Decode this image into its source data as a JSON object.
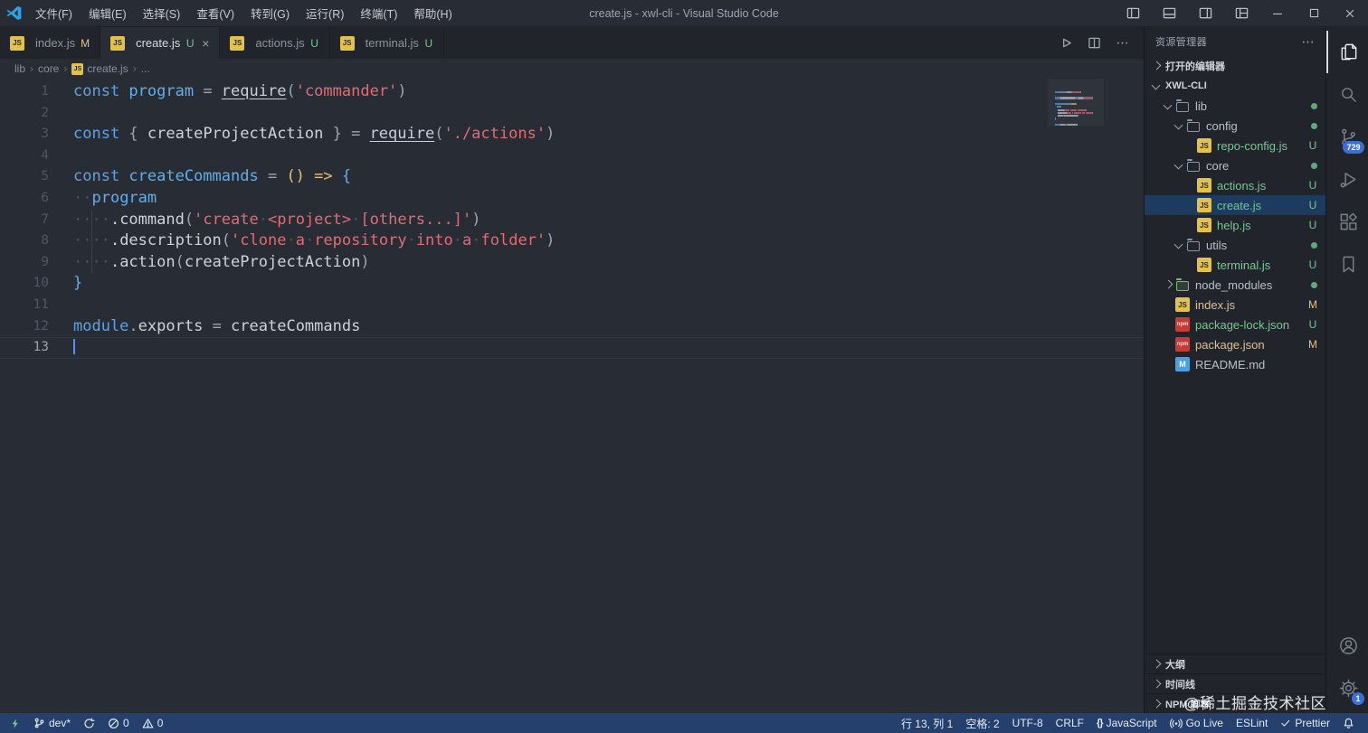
{
  "window": {
    "title": "create.js - xwl-cli - Visual Studio Code"
  },
  "menus": [
    "文件(F)",
    "编辑(E)",
    "选择(S)",
    "查看(V)",
    "转到(G)",
    "运行(R)",
    "终端(T)",
    "帮助(H)"
  ],
  "icon_glyphs": {
    "js": "JS",
    "npm": "npm",
    "md": "M"
  },
  "tabs": [
    {
      "label": "index.js",
      "badge": "M",
      "active": false
    },
    {
      "label": "create.js",
      "badge": "U",
      "active": true
    },
    {
      "label": "actions.js",
      "badge": "U",
      "active": false
    },
    {
      "label": "terminal.js",
      "badge": "U",
      "active": false
    }
  ],
  "breadcrumb": {
    "items": [
      {
        "label": "lib"
      },
      {
        "label": "core"
      },
      {
        "label": "create.js",
        "icon": "js"
      },
      {
        "label": "..."
      }
    ]
  },
  "editor": {
    "cursor_line": 13,
    "token_colors": {
      "kw": "#5da2e8",
      "id": "#61afef",
      "plain": "#ccd3dd",
      "pun": "#9da5b4",
      "str": "#e06c75",
      "gold": "#e5c07b",
      "ws": "#4a5160",
      "fn": "#c8cedb"
    },
    "lines": [
      {
        "n": 1,
        "t": [
          [
            "kw",
            "const "
          ],
          [
            "id",
            "program"
          ],
          [
            "pun",
            " = "
          ],
          [
            "fn",
            "require"
          ],
          [
            "pun",
            "("
          ],
          [
            "str",
            "'commander'"
          ],
          [
            "pun",
            ")"
          ]
        ]
      },
      {
        "n": 2,
        "t": []
      },
      {
        "n": 3,
        "t": [
          [
            "kw",
            "const "
          ],
          [
            "pun",
            "{ "
          ],
          [
            "plain",
            "createProjectAction"
          ],
          [
            "pun",
            " } = "
          ],
          [
            "fn",
            "require"
          ],
          [
            "pun",
            "("
          ],
          [
            "str",
            "'./actions'"
          ],
          [
            "pun",
            ")"
          ]
        ]
      },
      {
        "n": 4,
        "t": []
      },
      {
        "n": 5,
        "t": [
          [
            "kw",
            "const "
          ],
          [
            "id",
            "createCommands"
          ],
          [
            "pun",
            " = "
          ],
          [
            "gold",
            "() "
          ],
          [
            "gold",
            "=> "
          ],
          [
            "id",
            "{"
          ]
        ]
      },
      {
        "n": 6,
        "t": [
          [
            "ws",
            "··"
          ],
          [
            "id",
            "program"
          ]
        ]
      },
      {
        "n": 7,
        "t": [
          [
            "ws",
            "····"
          ],
          [
            "plain",
            ".command"
          ],
          [
            "pun",
            "("
          ],
          [
            "str",
            "'create"
          ],
          [
            "ws",
            "·"
          ],
          [
            "str",
            "<project>"
          ],
          [
            "ws",
            "·"
          ],
          [
            "str",
            "[others...]'"
          ],
          [
            "pun",
            ")"
          ]
        ]
      },
      {
        "n": 8,
        "t": [
          [
            "ws",
            "····"
          ],
          [
            "plain",
            ".description"
          ],
          [
            "pun",
            "("
          ],
          [
            "str",
            "'clone"
          ],
          [
            "ws",
            "·"
          ],
          [
            "str",
            "a"
          ],
          [
            "ws",
            "·"
          ],
          [
            "str",
            "repository"
          ],
          [
            "ws",
            "·"
          ],
          [
            "str",
            "into"
          ],
          [
            "ws",
            "·"
          ],
          [
            "str",
            "a"
          ],
          [
            "ws",
            "·"
          ],
          [
            "str",
            "folder'"
          ],
          [
            "pun",
            ")"
          ]
        ]
      },
      {
        "n": 9,
        "t": [
          [
            "ws",
            "····"
          ],
          [
            "plain",
            ".action"
          ],
          [
            "pun",
            "("
          ],
          [
            "plain",
            "createProjectAction"
          ],
          [
            "pun",
            ")"
          ]
        ]
      },
      {
        "n": 10,
        "t": [
          [
            "id",
            "}"
          ]
        ]
      },
      {
        "n": 11,
        "t": []
      },
      {
        "n": 12,
        "t": [
          [
            "kw",
            "module"
          ],
          [
            "pun",
            "."
          ],
          [
            "plain",
            "exports"
          ],
          [
            "pun",
            " = "
          ],
          [
            "plain",
            "createCommands"
          ]
        ]
      },
      {
        "n": 13,
        "t": []
      }
    ]
  },
  "sidebar": {
    "title": "资源管理器",
    "open_editors_label": "打开的编辑器",
    "project": "XWL-CLI",
    "tree": [
      {
        "indent": 0,
        "chev": "down",
        "icon": "folder",
        "label": "lib",
        "dot": true
      },
      {
        "indent": 1,
        "chev": "down",
        "icon": "folder",
        "label": "config",
        "dot": true
      },
      {
        "indent": 2,
        "icon": "js",
        "label": "repo-config.js",
        "git": "U"
      },
      {
        "indent": 1,
        "chev": "down",
        "icon": "folder",
        "label": "core",
        "dot": true
      },
      {
        "indent": 2,
        "icon": "js",
        "label": "actions.js",
        "git": "U"
      },
      {
        "indent": 2,
        "icon": "js",
        "label": "create.js",
        "git": "U",
        "selected": true
      },
      {
        "indent": 2,
        "icon": "js",
        "label": "help.js",
        "git": "U"
      },
      {
        "indent": 1,
        "chev": "down",
        "icon": "folder",
        "label": "utils",
        "dot": true
      },
      {
        "indent": 2,
        "icon": "js",
        "label": "terminal.js",
        "git": "U"
      },
      {
        "indent": 0,
        "chev": "right",
        "icon": "folder-node",
        "label": "node_modules",
        "dot": true
      },
      {
        "indent": 0,
        "icon": "js",
        "label": "index.js",
        "git": "M"
      },
      {
        "indent": 0,
        "icon": "npm",
        "label": "package-lock.json",
        "git": "U"
      },
      {
        "indent": 0,
        "icon": "npm",
        "label": "package.json",
        "git": "M"
      },
      {
        "indent": 0,
        "icon": "md",
        "label": "README.md"
      }
    ],
    "bottom_sections": [
      "大纲",
      "时间线",
      "NPM 脚本"
    ]
  },
  "activity_bar": {
    "top": [
      {
        "name": "explorer",
        "active": true
      },
      {
        "name": "search"
      },
      {
        "name": "source-control",
        "badge": "729"
      },
      {
        "name": "run-debug"
      },
      {
        "name": "extensions"
      },
      {
        "name": "bookmarks"
      }
    ],
    "bottom": [
      {
        "name": "account"
      },
      {
        "name": "settings",
        "badge": "1"
      }
    ]
  },
  "status_bar": {
    "left": [
      {
        "name": "remote",
        "icon": "lightning",
        "color": "#73c991"
      },
      {
        "name": "branch",
        "icon": "branch",
        "label": "dev*"
      },
      {
        "name": "sync",
        "icon": "sync"
      },
      {
        "name": "errors",
        "icon": "error",
        "label": "0"
      },
      {
        "name": "warnings",
        "icon": "warning",
        "label": "0"
      }
    ],
    "right": [
      {
        "name": "cursor-position",
        "label": "行 13, 列 1"
      },
      {
        "name": "indentation",
        "label": "空格: 2"
      },
      {
        "name": "encoding",
        "label": "UTF-8"
      },
      {
        "name": "eol",
        "label": "CRLF"
      },
      {
        "name": "language-mode",
        "icon": "braces",
        "label": "JavaScript"
      },
      {
        "name": "go-live",
        "icon": "broadcast",
        "label": "Go Live"
      },
      {
        "name": "eslint",
        "label": "ESLint"
      },
      {
        "name": "prettier",
        "icon": "check",
        "label": "Prettier"
      },
      {
        "name": "notifications",
        "icon": "bell"
      }
    ]
  },
  "watermark": "@稀土掘金技术社区",
  "colors": {
    "accent_blue": "#61afef",
    "git_untracked": "#73c991",
    "git_modified": "#e2c08d",
    "badge_blue": "#3d6fd6",
    "statusbar_bg": "#26406e",
    "selection_bg": "#1d3a5f",
    "editor_bg": "#282c34",
    "panel_bg": "#21252b"
  }
}
